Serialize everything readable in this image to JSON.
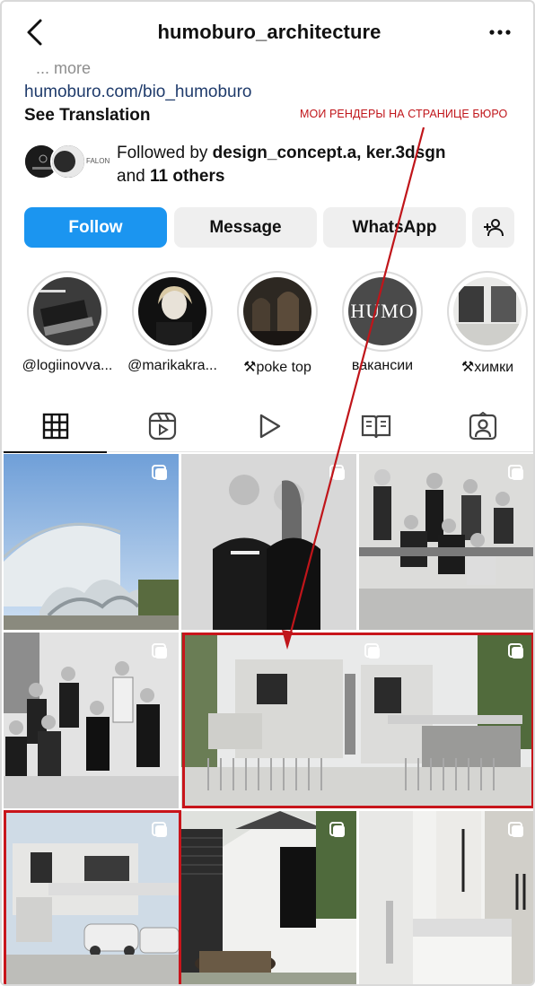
{
  "header": {
    "username": "humoburo_architecture"
  },
  "bio": {
    "more": "... more",
    "link": "humoburo.com/bio_humoburo",
    "see_translation": "See Translation"
  },
  "annotation": {
    "text": "МОИ РЕНДЕРЫ НА СТРАНИЦЕ БЮРО",
    "color": "#c0151a"
  },
  "followers": {
    "prefix": "Followed by ",
    "names": "design_concept.a, ker.3dsgn",
    "and": "and ",
    "others": "11 others",
    "avatar2_label": "FALON"
  },
  "buttons": {
    "follow": "Follow",
    "message": "Message",
    "whatsapp": "WhatsApp",
    "add_user_icon": "add-user-icon"
  },
  "highlights": [
    {
      "label": "@logiinovva..."
    },
    {
      "label": "@marikakra..."
    },
    {
      "label": "⚒poke top"
    },
    {
      "label": "вакансии",
      "logo": "HUMO"
    },
    {
      "label": "⚒химки"
    }
  ],
  "tabs": [
    {
      "icon": "grid-icon",
      "active": true
    },
    {
      "icon": "reels-icon",
      "active": false
    },
    {
      "icon": "play-icon",
      "active": false
    },
    {
      "icon": "guides-icon",
      "active": false
    },
    {
      "icon": "tagged-icon",
      "active": false
    }
  ],
  "colors": {
    "follow": "#1b95f0",
    "highlight_box": "#c8151b",
    "link": "#1f3b6b"
  }
}
